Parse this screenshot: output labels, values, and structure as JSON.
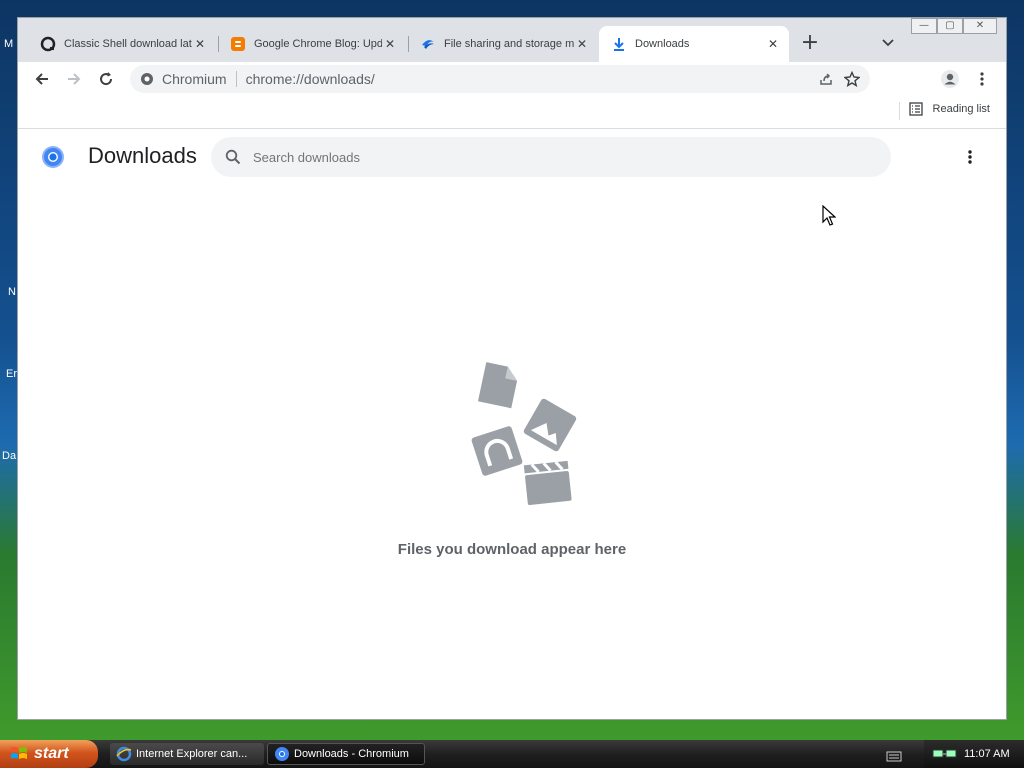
{
  "desktop": {
    "icon_labels": [
      "M",
      "N",
      "Er",
      "Da"
    ]
  },
  "window": {
    "controls": {
      "minimize": "—",
      "maximize": "▢",
      "close": "✕"
    }
  },
  "tabs": [
    {
      "title": "Classic Shell download lat",
      "icon": "classic-shell-icon"
    },
    {
      "title": "Google Chrome Blog: Upd",
      "icon": "blogger-icon"
    },
    {
      "title": "File sharing and storage m",
      "icon": "file-sharing-icon"
    },
    {
      "title": "Downloads",
      "icon": "download-icon",
      "active": true
    }
  ],
  "toolbar": {
    "site_name": "Chromium",
    "url": "chrome://downloads/"
  },
  "bookmark_bar": {
    "reading_list": "Reading list"
  },
  "page": {
    "title": "Downloads",
    "search_placeholder": "Search downloads",
    "empty_message": "Files you download appear here"
  },
  "taskbar": {
    "start": "start",
    "items": [
      {
        "label": "Internet Explorer can...",
        "icon": "internet-explorer-icon"
      },
      {
        "label": "Downloads - Chromium",
        "icon": "chromium-icon",
        "active": true
      }
    ],
    "clock": "11:07 AM"
  },
  "colors": {
    "accent_blue": "#1a73e8",
    "tab_strip": "#dee1e6",
    "empty_art": "#9aa0a6"
  }
}
